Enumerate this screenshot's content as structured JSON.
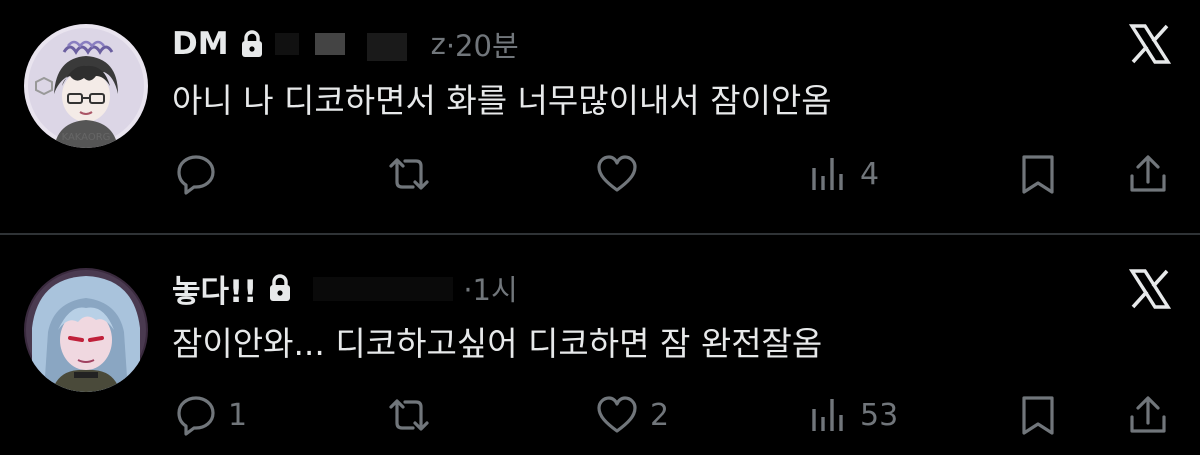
{
  "posts": [
    {
      "name": "DM",
      "handle_tail": "z",
      "time": "·20분",
      "text": "아니 나 디코하면서 화를 너무많이내서 잠이안옴",
      "avatar_label": "KAKAORG",
      "stats": {
        "replies": "",
        "retweets": "",
        "likes": "",
        "views": "4"
      }
    },
    {
      "name": "놓다!!",
      "handle_tail": "",
      "time": "·1시",
      "text": "잠이안와... 디코하고싶어 디코하면 잠 완전잘옴",
      "stats": {
        "replies": "1",
        "retweets": "",
        "likes": "2",
        "views": "53"
      }
    }
  ],
  "colors": {
    "background": "#000000",
    "text": "#e7e9ea",
    "muted": "#71767b",
    "divider": "#2f3336"
  },
  "icons": {
    "reply": "speech-bubble-icon",
    "retweet": "retweet-arrows-icon",
    "like": "heart-icon",
    "views": "bar-chart-icon",
    "bookmark": "bookmark-icon",
    "share": "share-upload-icon",
    "lock": "lock-icon",
    "x": "x-logo-icon"
  }
}
